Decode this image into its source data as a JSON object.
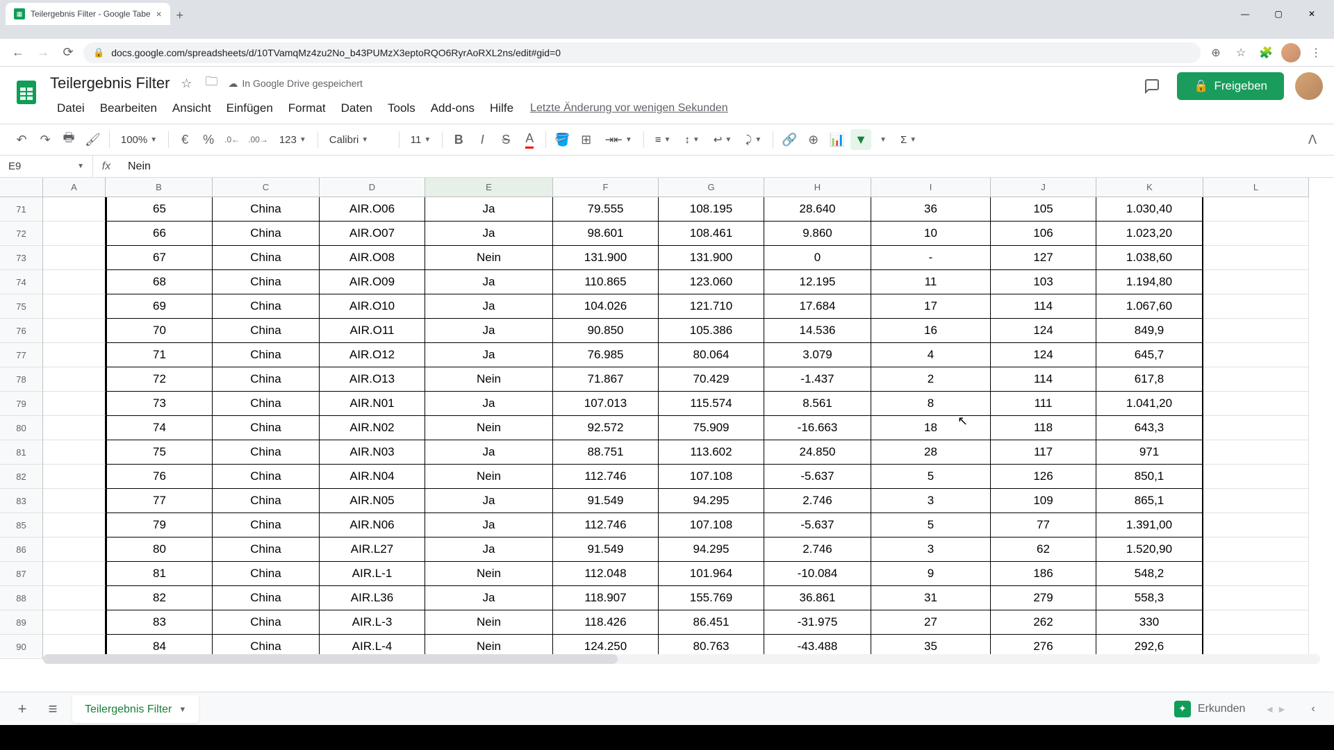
{
  "browser": {
    "tab_title": "Teilergebnis Filter - Google Tabe",
    "url": "docs.google.com/spreadsheets/d/10TVamqMz4zu2No_b43PUMzX3eptoRQO6RyrAoRXL2ns/edit#gid=0"
  },
  "doc": {
    "title": "Teilergebnis Filter",
    "save_status": "In Google Drive gespeichert",
    "last_edit": "Letzte Änderung vor wenigen Sekunden"
  },
  "menu": {
    "file": "Datei",
    "edit": "Bearbeiten",
    "view": "Ansicht",
    "insert": "Einfügen",
    "format": "Format",
    "data": "Daten",
    "tools": "Tools",
    "addons": "Add-ons",
    "help": "Hilfe"
  },
  "toolbar": {
    "zoom": "100%",
    "currency": "€",
    "percent": "%",
    "dec_dec": ".0",
    "inc_dec": ".00",
    "format_num": "123",
    "font": "Calibri",
    "font_size": "11"
  },
  "share": {
    "label": "Freigeben"
  },
  "namebox": {
    "ref": "E9"
  },
  "formula": {
    "value": "Nein"
  },
  "columns": [
    "A",
    "B",
    "C",
    "D",
    "E",
    "F",
    "G",
    "H",
    "I",
    "J",
    "K",
    "L"
  ],
  "col_widths": {
    "A": 90,
    "B": 154,
    "C": 154,
    "D": 152,
    "E": 184,
    "F": 152,
    "G": 152,
    "H": 154,
    "I": 172,
    "J": 152,
    "K": 154,
    "L": 152
  },
  "selected_col": "E",
  "row_nums": [
    "71",
    "72",
    "73",
    "74",
    "75",
    "76",
    "77",
    "78",
    "79",
    "80",
    "81",
    "82",
    "83",
    "85",
    "86",
    "87",
    "88",
    "89",
    "90"
  ],
  "rows": [
    {
      "A": "",
      "B": "65",
      "C": "China",
      "D": "AIR.O06",
      "E": "Ja",
      "F": "79.555",
      "G": "108.195",
      "H": "28.640",
      "I": "36",
      "J": "105",
      "K": "1.030,40"
    },
    {
      "A": "",
      "B": "66",
      "C": "China",
      "D": "AIR.O07",
      "E": "Ja",
      "F": "98.601",
      "G": "108.461",
      "H": "9.860",
      "I": "10",
      "J": "106",
      "K": "1.023,20"
    },
    {
      "A": "",
      "B": "67",
      "C": "China",
      "D": "AIR.O08",
      "E": "Nein",
      "F": "131.900",
      "G": "131.900",
      "H": "0",
      "I": "-",
      "J": "127",
      "K": "1.038,60"
    },
    {
      "A": "",
      "B": "68",
      "C": "China",
      "D": "AIR.O09",
      "E": "Ja",
      "F": "110.865",
      "G": "123.060",
      "H": "12.195",
      "I": "11",
      "J": "103",
      "K": "1.194,80"
    },
    {
      "A": "",
      "B": "69",
      "C": "China",
      "D": "AIR.O10",
      "E": "Ja",
      "F": "104.026",
      "G": "121.710",
      "H": "17.684",
      "I": "17",
      "J": "114",
      "K": "1.067,60"
    },
    {
      "A": "",
      "B": "70",
      "C": "China",
      "D": "AIR.O11",
      "E": "Ja",
      "F": "90.850",
      "G": "105.386",
      "H": "14.536",
      "I": "16",
      "J": "124",
      "K": "849,9"
    },
    {
      "A": "",
      "B": "71",
      "C": "China",
      "D": "AIR.O12",
      "E": "Ja",
      "F": "76.985",
      "G": "80.064",
      "H": "3.079",
      "I": "4",
      "J": "124",
      "K": "645,7"
    },
    {
      "A": "",
      "B": "72",
      "C": "China",
      "D": "AIR.O13",
      "E": "Nein",
      "F": "71.867",
      "G": "70.429",
      "H": "-1.437",
      "I": "2",
      "J": "114",
      "K": "617,8"
    },
    {
      "A": "",
      "B": "73",
      "C": "China",
      "D": "AIR.N01",
      "E": "Ja",
      "F": "107.013",
      "G": "115.574",
      "H": "8.561",
      "I": "8",
      "J": "111",
      "K": "1.041,20"
    },
    {
      "A": "",
      "B": "74",
      "C": "China",
      "D": "AIR.N02",
      "E": "Nein",
      "F": "92.572",
      "G": "75.909",
      "H": "-16.663",
      "I": "18",
      "J": "118",
      "K": "643,3"
    },
    {
      "A": "",
      "B": "75",
      "C": "China",
      "D": "AIR.N03",
      "E": "Ja",
      "F": "88.751",
      "G": "113.602",
      "H": "24.850",
      "I": "28",
      "J": "117",
      "K": "971"
    },
    {
      "A": "",
      "B": "76",
      "C": "China",
      "D": "AIR.N04",
      "E": "Nein",
      "F": "112.746",
      "G": "107.108",
      "H": "-5.637",
      "I": "5",
      "J": "126",
      "K": "850,1"
    },
    {
      "A": "",
      "B": "77",
      "C": "China",
      "D": "AIR.N05",
      "E": "Ja",
      "F": "91.549",
      "G": "94.295",
      "H": "2.746",
      "I": "3",
      "J": "109",
      "K": "865,1"
    },
    {
      "A": "",
      "B": "79",
      "C": "China",
      "D": "AIR.N06",
      "E": "Ja",
      "F": "112.746",
      "G": "107.108",
      "H": "-5.637",
      "I": "5",
      "J": "77",
      "K": "1.391,00"
    },
    {
      "A": "",
      "B": "80",
      "C": "China",
      "D": "AIR.L27",
      "E": "Ja",
      "F": "91.549",
      "G": "94.295",
      "H": "2.746",
      "I": "3",
      "J": "62",
      "K": "1.520,90"
    },
    {
      "A": "",
      "B": "81",
      "C": "China",
      "D": "AIR.L-1",
      "E": "Nein",
      "F": "112.048",
      "G": "101.964",
      "H": "-10.084",
      "I": "9",
      "J": "186",
      "K": "548,2"
    },
    {
      "A": "",
      "B": "82",
      "C": "China",
      "D": "AIR.L36",
      "E": "Ja",
      "F": "118.907",
      "G": "155.769",
      "H": "36.861",
      "I": "31",
      "J": "279",
      "K": "558,3"
    },
    {
      "A": "",
      "B": "83",
      "C": "China",
      "D": "AIR.L-3",
      "E": "Nein",
      "F": "118.426",
      "G": "86.451",
      "H": "-31.975",
      "I": "27",
      "J": "262",
      "K": "330"
    },
    {
      "A": "",
      "B": "84",
      "C": "China",
      "D": "AIR.L-4",
      "E": "Nein",
      "F": "124.250",
      "G": "80.763",
      "H": "-43.488",
      "I": "35",
      "J": "276",
      "K": "292,6"
    }
  ],
  "sheet_tab": {
    "name": "Teilergebnis Filter"
  },
  "explore": {
    "label": "Erkunden"
  }
}
